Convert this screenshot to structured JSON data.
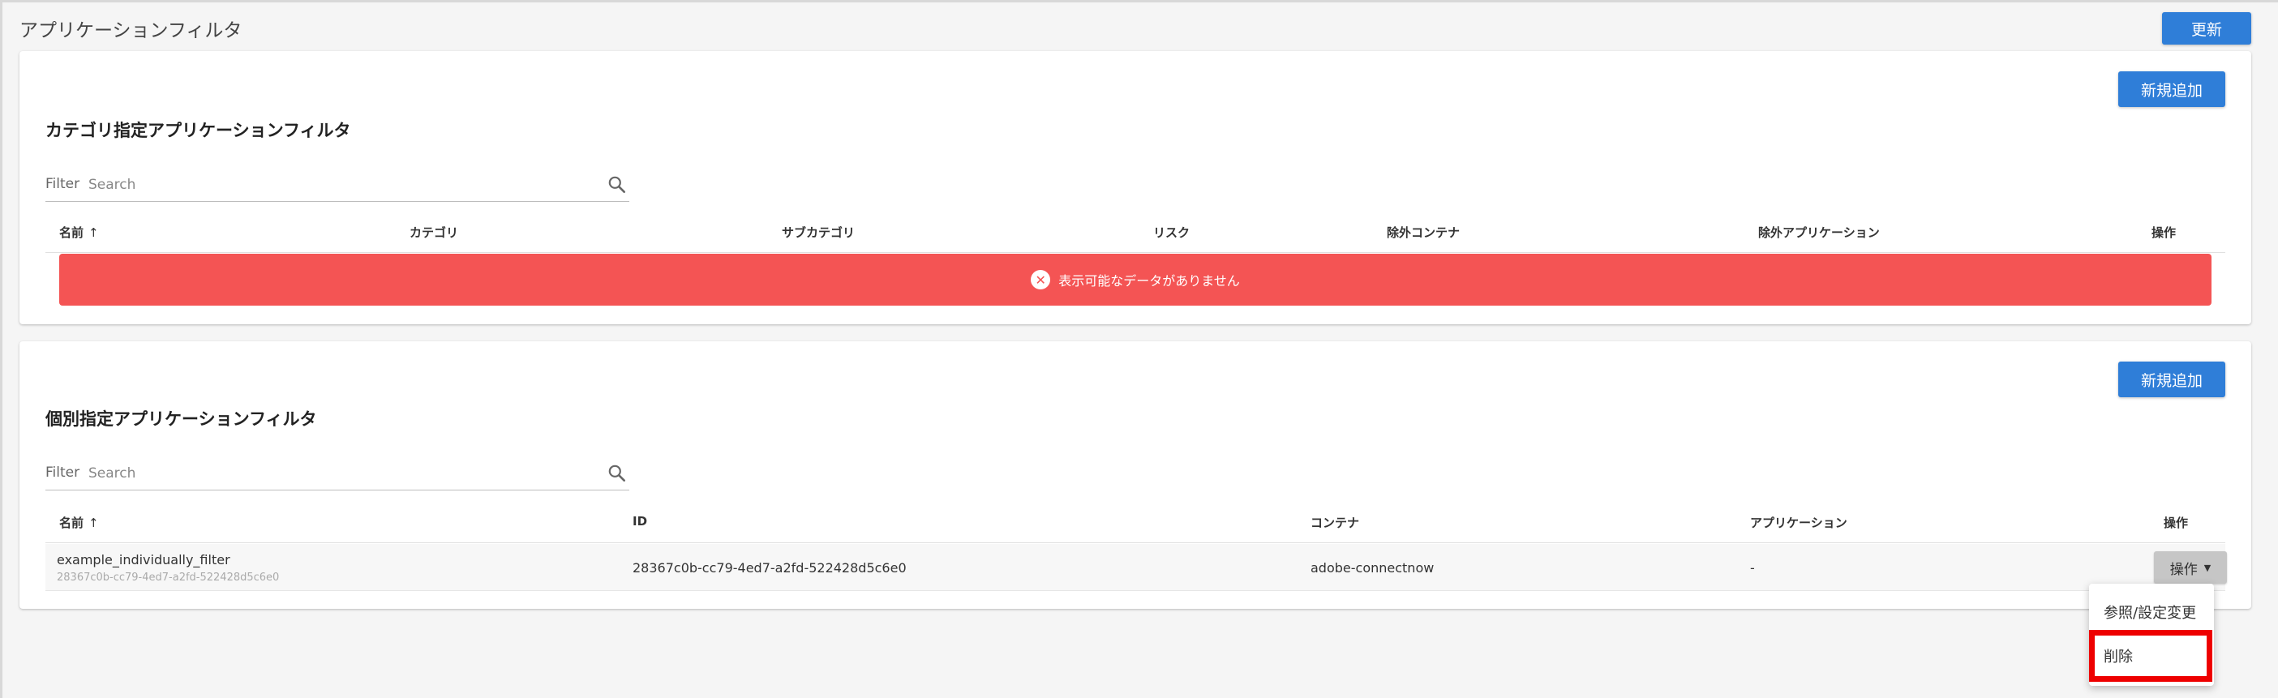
{
  "page": {
    "title": "アプリケーションフィルタ",
    "refresh_label": "更新"
  },
  "colors": {
    "primary": "#2f7ed8",
    "error_bg": "#f45454",
    "highlight": "#ee0000"
  },
  "category_section": {
    "title": "カテゴリ指定アプリケーションフィルタ",
    "add_label": "新規追加",
    "filter_label": "Filter",
    "search_placeholder": "Search",
    "columns": [
      "名前",
      "カテゴリ",
      "サブカテゴリ",
      "リスク",
      "除外コンテナ",
      "除外アプリケーション",
      "操作"
    ],
    "sort_indicator": "↑",
    "empty_message": "表示可能なデータがありません",
    "empty_icon": "circle-x-icon"
  },
  "individual_section": {
    "title": "個別指定アプリケーションフィルタ",
    "add_label": "新規追加",
    "filter_label": "Filter",
    "search_placeholder": "Search",
    "columns": [
      "名前",
      "ID",
      "コンテナ",
      "アプリケーション",
      "操作"
    ],
    "sort_indicator": "↑",
    "rows": [
      {
        "name": "example_individually_filter",
        "name_sub": "28367c0b-cc79-4ed7-a2fd-522428d5c6e0",
        "id": "28367c0b-cc79-4ed7-a2fd-522428d5c6e0",
        "container": "adobe-connectnow",
        "application": "-",
        "ops_label": "操作"
      }
    ]
  },
  "ops_menu": {
    "items": [
      "参照/設定変更",
      "削除"
    ],
    "highlighted": "削除"
  }
}
